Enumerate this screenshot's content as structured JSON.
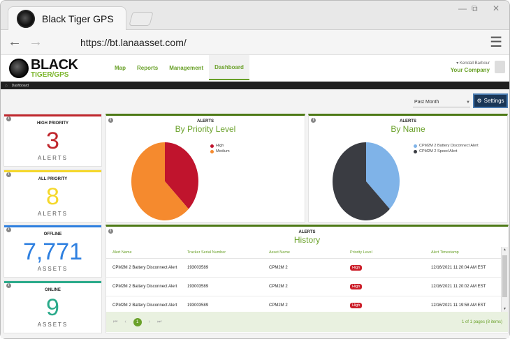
{
  "browser": {
    "tab_title": "Black Tiger GPS",
    "url": "https://bt.lanaasset.com/",
    "win_minimize": "—",
    "win_maximize": "⧉",
    "win_close": "✕"
  },
  "brand": {
    "line1": "BLACK",
    "line2": "TIGER/GPS"
  },
  "nav": {
    "items": [
      "Map",
      "Reports",
      "Management",
      "Dashboard"
    ],
    "active": "Dashboard"
  },
  "user": {
    "name": "Kendall Barbour",
    "company": "Your Company"
  },
  "breadcrumb": "Dashboard",
  "filter": {
    "selected": "Past Month"
  },
  "settings_label": "Settings",
  "stats": [
    {
      "label": "HIGH PRIORITY",
      "value": "3",
      "unit": "ALERTS",
      "color": "#c0272d"
    },
    {
      "label": "ALL PRIORITY",
      "value": "8",
      "unit": "ALERTS",
      "color": "#f5d82b"
    },
    {
      "label": "OFFLINE",
      "value": "7,771",
      "unit": "ASSETS",
      "color": "#2d7fe0"
    },
    {
      "label": "ONLINE",
      "value": "9",
      "unit": "ASSETS",
      "color": "#2aaa8a"
    }
  ],
  "charts": {
    "priority": {
      "kicker": "ALERTS",
      "title": "By Priority Level",
      "legend": [
        "High",
        "Medium"
      ],
      "colors": [
        "#c0142d",
        "#f58a2e"
      ],
      "values": [
        3,
        5
      ]
    },
    "name": {
      "kicker": "ALERTS",
      "title": "By Name",
      "legend": [
        "CPM2M 2 Battery Disconnect Alert",
        "CPM2M 2 Speed Alert"
      ],
      "colors": [
        "#7fb3e8",
        "#3a3c42"
      ],
      "values": [
        3,
        5
      ]
    }
  },
  "history": {
    "kicker": "ALERTS",
    "title": "History",
    "columns": [
      "Alert Name",
      "Tracker Serial Number",
      "Asset Name",
      "Priority Level",
      "Alert Timestamp"
    ],
    "rows": [
      [
        "CPM2M 2 Battery Disconnect Alert",
        "193003589",
        "CPM2M 2",
        "High",
        "12/16/2021 11:20:04 AM EST"
      ],
      [
        "CPM2M 2 Battery Disconnect Alert",
        "193003589",
        "CPM2M 2",
        "High",
        "12/16/2021 11:20:02 AM EST"
      ],
      [
        "CPM2M 2 Battery Disconnect Alert",
        "193003589",
        "CPM2M 2",
        "High",
        "12/16/2021 11:19:58 AM EST"
      ]
    ],
    "current_page": "1",
    "page_info": "1 of 1 pages (8 items)"
  }
}
